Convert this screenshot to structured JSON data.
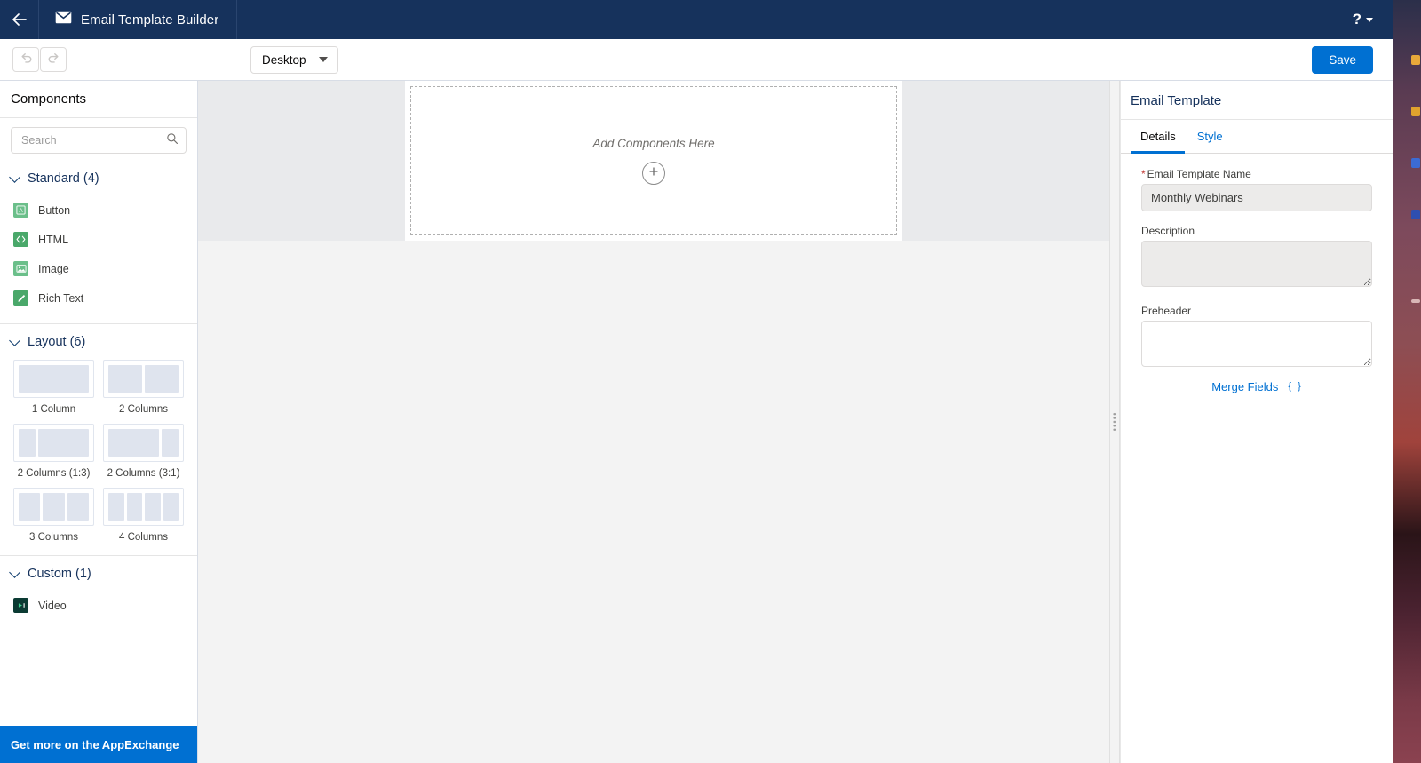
{
  "header": {
    "back_icon": "arrow-left-icon",
    "app_icon": "envelope-icon",
    "title": "Email Template Builder",
    "help_icon": "question-mark-icon",
    "help_label": "?"
  },
  "toolbar": {
    "undo_icon": "undo-icon",
    "redo_icon": "redo-icon",
    "device_label": "Desktop",
    "save_label": "Save"
  },
  "sidebar": {
    "title": "Components",
    "search": {
      "placeholder": "Search",
      "value": "",
      "icon": "search-icon"
    },
    "sections": [
      {
        "title": "Standard (4)",
        "items": [
          {
            "label": "Button",
            "icon": "button-component-icon",
            "glyph": "A"
          },
          {
            "label": "HTML",
            "icon": "html-component-icon",
            "glyph": "</>"
          },
          {
            "label": "Image",
            "icon": "image-component-icon",
            "glyph": "▣"
          },
          {
            "label": "Rich Text",
            "icon": "rich-text-component-icon",
            "glyph": "✎"
          }
        ]
      },
      {
        "title": "Layout (6)",
        "layouts": [
          {
            "label": "1 Column",
            "cols": [
              1
            ]
          },
          {
            "label": "2 Columns",
            "cols": [
              1,
              1
            ]
          },
          {
            "label": "2 Columns (1:3)",
            "cols": [
              1,
              3
            ]
          },
          {
            "label": "2 Columns (3:1)",
            "cols": [
              3,
              1
            ]
          },
          {
            "label": "3 Columns",
            "cols": [
              1,
              1,
              1
            ]
          },
          {
            "label": "4 Columns",
            "cols": [
              1,
              1,
              1,
              1
            ]
          }
        ]
      },
      {
        "title": "Custom (1)",
        "items": [
          {
            "label": "Video",
            "icon": "video-component-icon",
            "glyph": "▶"
          }
        ]
      }
    ],
    "appexchange_label": "Get more on the AppExchange"
  },
  "canvas": {
    "dropzone_hint": "Add Components Here",
    "add_button_icon": "plus-icon",
    "add_button_label": "+"
  },
  "splitter": {
    "icon": "drag-handle-icon"
  },
  "right_panel": {
    "title": "Email Template",
    "tabs": [
      {
        "label": "Details",
        "active": true
      },
      {
        "label": "Style",
        "active": false
      }
    ],
    "fields": {
      "name_label": "Email Template Name",
      "name_required": "*",
      "name_value": "Monthly Webinars",
      "description_label": "Description",
      "description_value": "",
      "preheader_label": "Preheader",
      "preheader_value": "",
      "merge_fields_label": "Merge Fields",
      "merge_fields_glyph": "{ }"
    }
  },
  "colors": {
    "header_bg": "#16325c",
    "accent_blue": "#0070d2",
    "link_blue": "#16325c",
    "required_red": "#c23934",
    "canvas_bg": "#f3f3f3",
    "stage_bg": "#e9eaec"
  }
}
